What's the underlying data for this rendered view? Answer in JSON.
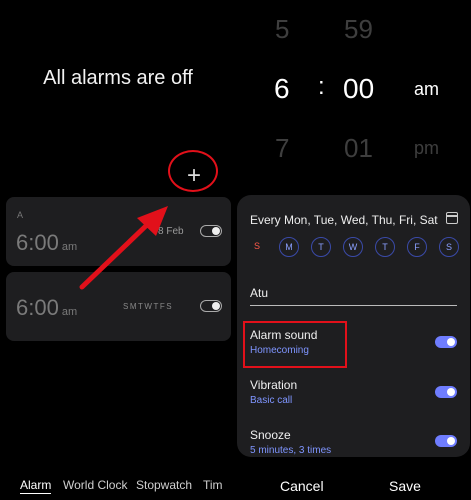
{
  "left": {
    "status_title": "All alarms are off",
    "add_glyph": "+",
    "alarms": [
      {
        "label": "A",
        "time": "6:00",
        "ampm": "am",
        "date": "8 Feb",
        "enabled": false
      },
      {
        "label": "",
        "time": "6:00",
        "ampm": "am",
        "days": "SMTWTFS",
        "enabled": false
      }
    ]
  },
  "bottom_nav": {
    "tabs": [
      "Alarm",
      "World Clock",
      "Stopwatch",
      "Tim"
    ]
  },
  "picker": {
    "hour_prev": "5",
    "hour": "6",
    "hour_next": "7",
    "separator": ":",
    "minute_prev": "59",
    "minute": "00",
    "minute_next": "01",
    "period": "am",
    "period_alt": "pm"
  },
  "editor": {
    "repeat": "Every Mon, Tue, Wed, Thu, Fri, Sat",
    "days": [
      "S",
      "M",
      "T",
      "W",
      "T",
      "F",
      "S"
    ],
    "name": "Atu",
    "options": [
      {
        "title": "Alarm sound",
        "subtitle": "Homecoming",
        "enabled": true
      },
      {
        "title": "Vibration",
        "subtitle": "Basic call",
        "enabled": true
      },
      {
        "title": "Snooze",
        "subtitle": "5 minutes, 3 times",
        "enabled": true
      }
    ],
    "cancel_label": "Cancel",
    "save_label": "Save"
  },
  "colors": {
    "accent": "#6f7dff",
    "annotation": "#e2101a",
    "sunday": "#ff5a4a"
  }
}
